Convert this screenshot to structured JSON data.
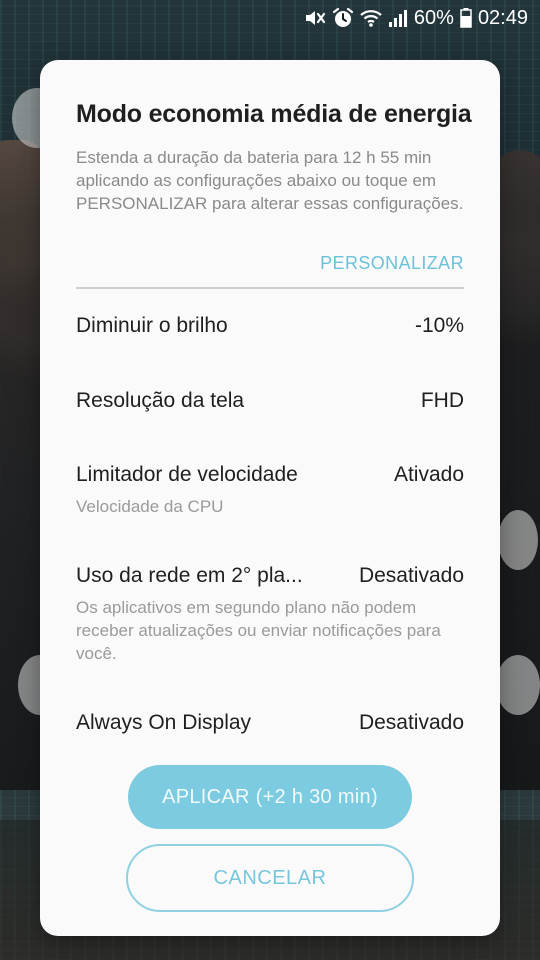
{
  "status_bar": {
    "battery_percent": "60%",
    "time": "02:49",
    "icons": [
      "mute-icon",
      "alarm-icon",
      "wifi-icon",
      "signal-icon",
      "battery-icon"
    ]
  },
  "dialog": {
    "title": "Modo economia média de energia",
    "description": "Estenda a duração da bateria para 12 h 55 min aplicando as configurações abaixo ou toque em PERSONALIZAR para alterar essas configurações.",
    "customize_label": "PERSONALIZAR",
    "settings": [
      {
        "label": "Diminuir o brilho",
        "value": "-10%",
        "sub": ""
      },
      {
        "label": "Resolução da tela",
        "value": "FHD",
        "sub": ""
      },
      {
        "label": "Limitador de velocidade",
        "value": "Ativado",
        "sub": "Velocidade da CPU"
      },
      {
        "label": "Uso da rede em 2° pla...",
        "value": "Desativado",
        "sub": "Os aplicativos em segundo plano não podem receber atualizações ou enviar notificações para você."
      },
      {
        "label": "Always On Display",
        "value": "Desativado",
        "sub": ""
      }
    ],
    "apply_label": "APLICAR (+2 h 30 min)",
    "cancel_label": "CANCELAR"
  },
  "colors": {
    "accent": "#6cc2d8",
    "apply_button": "#7ccbe0",
    "dialog_bg": "#fafafa"
  }
}
